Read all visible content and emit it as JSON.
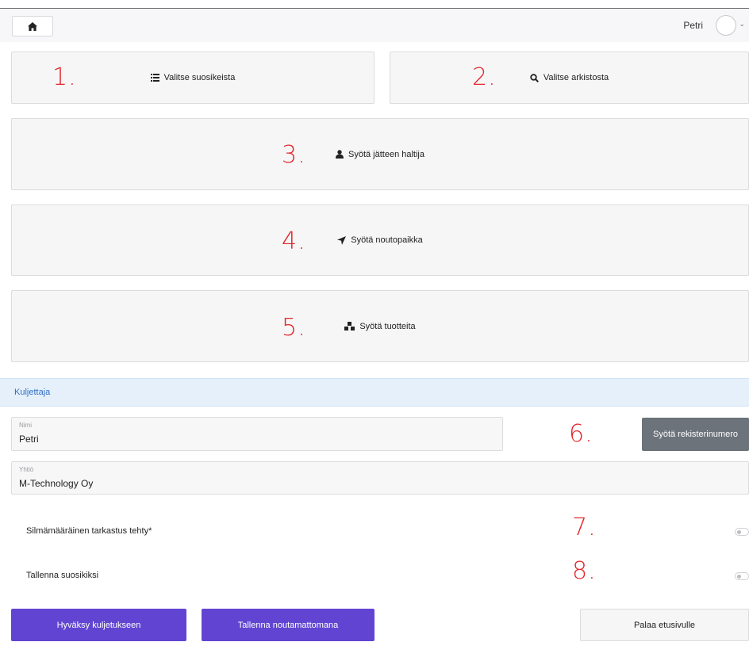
{
  "header": {
    "home_icon": "home-icon",
    "user_name": "Petri"
  },
  "options": {
    "favorites_label": "Valitse suosikeista",
    "archive_label": "Valitse arkistosta",
    "holder_label": "Syötä jätteen haltija",
    "pickup_label": "Syötä noutopaikka",
    "products_label": "Syötä tuotteita"
  },
  "annotations": [
    "1.",
    "2.",
    "3.",
    "4.",
    "5.",
    "6.",
    "7.",
    "8."
  ],
  "driver_section": {
    "title": "Kuljettaja",
    "name_label": "Nimi",
    "name_value": "Petri",
    "company_label": "Yhtiö",
    "company_value": "M-Technology Oy",
    "register_button": "Syötä rekisterinumero",
    "visual_check_label": "Silmämääräinen tarkastus tehty*",
    "visual_check_on": false,
    "save_favorite_label": "Tallenna suosikiksi",
    "save_favorite_on": false
  },
  "actions": {
    "approve": "Hyväksy kuljetukseen",
    "save_uncollected": "Tallenna noutamattomana",
    "back_home": "Palaa etusivulle"
  },
  "colors": {
    "annotation_red": "#e3262b",
    "primary_purple": "#6145d2",
    "secondary_gray": "#6c737a",
    "section_blue": "#e5f0fb"
  }
}
